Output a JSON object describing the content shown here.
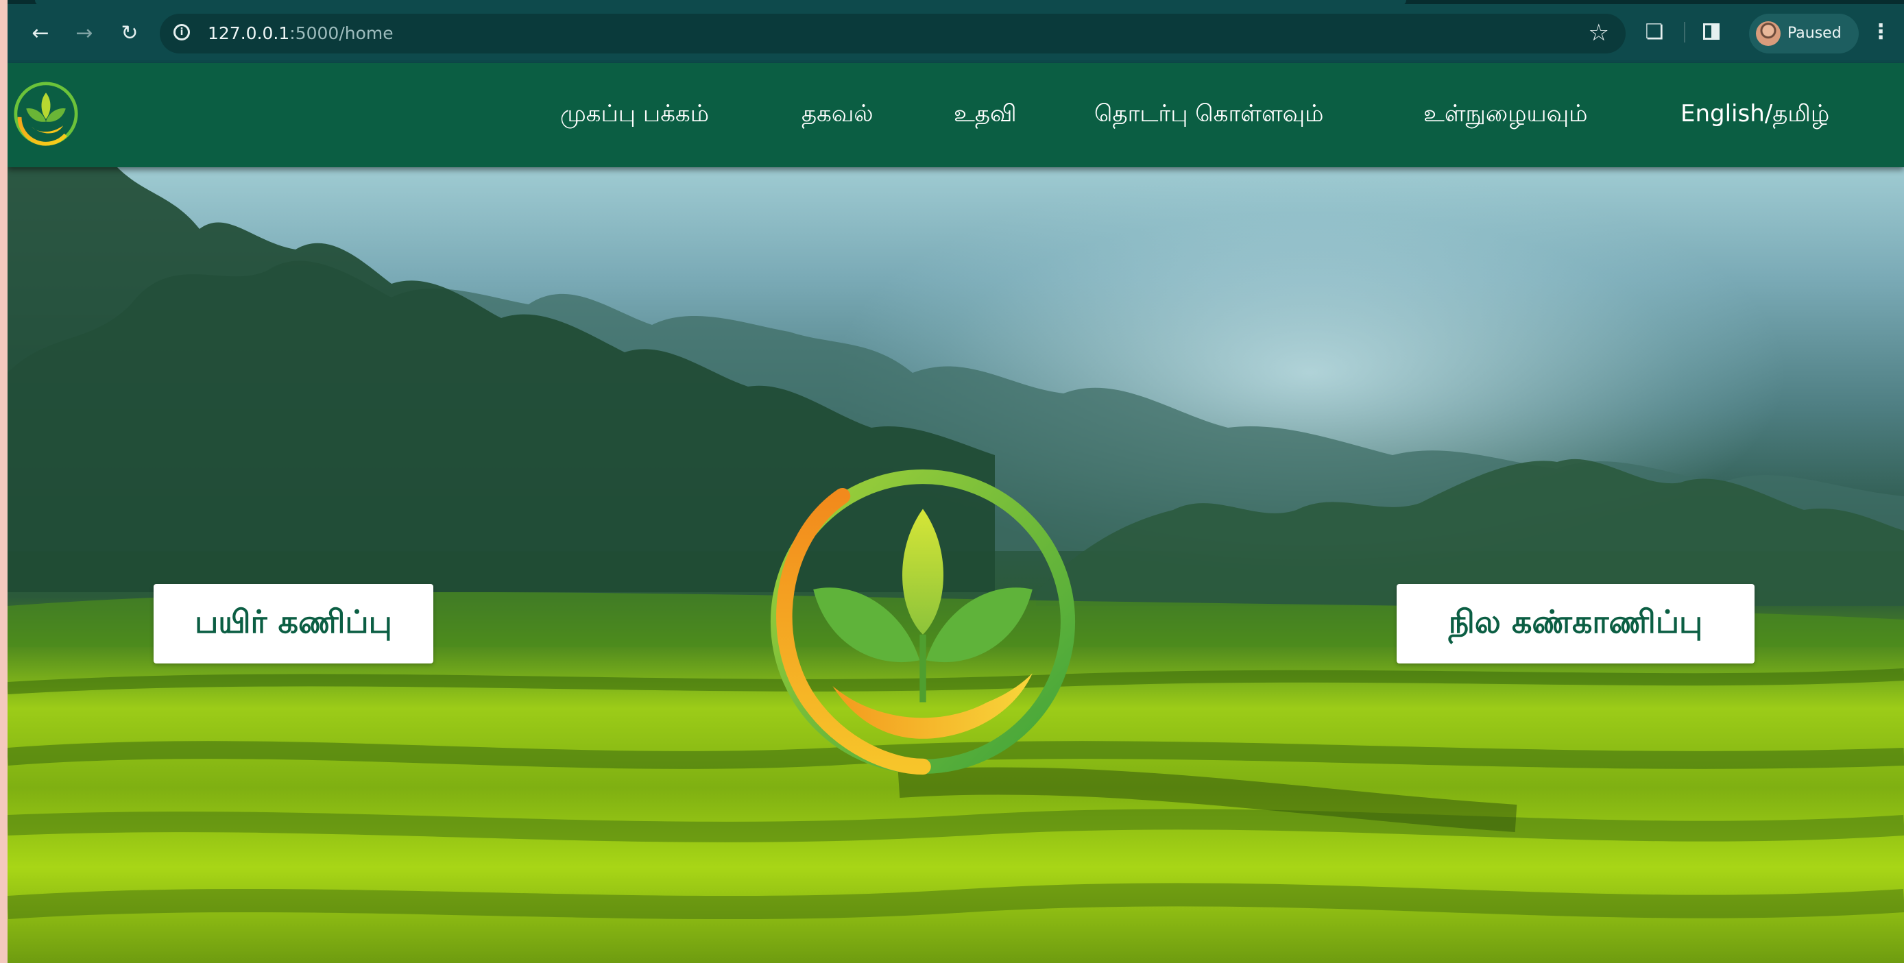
{
  "browser": {
    "url_host": "127.0.0.1",
    "url_path": ":5000/home",
    "profile_status": "Paused",
    "icons": {
      "back": "arrow-left-icon",
      "forward": "arrow-right-icon",
      "reload": "reload-icon",
      "site_info": "info-icon",
      "bookmark": "star-icon",
      "extensions": "puzzle-icon",
      "side_panel": "side-panel-icon",
      "menu": "kebab-menu-icon"
    }
  },
  "site": {
    "nav": [
      {
        "label": "முகப்பு பக்கம்"
      },
      {
        "label": "தகவல்"
      },
      {
        "label": "உதவி"
      },
      {
        "label": "தொடர்பு கொள்ளவும்"
      },
      {
        "label": "உள்நுழையவும்"
      },
      {
        "label": "English/தமிழ்"
      }
    ],
    "colors": {
      "header_bg": "#0b5e43",
      "button_text": "#0b5e43",
      "button_bg": "#ffffff"
    }
  },
  "hero": {
    "left_button": "பயிர் கணிப்பு",
    "right_button": "நில கண்காணிப்பு"
  }
}
